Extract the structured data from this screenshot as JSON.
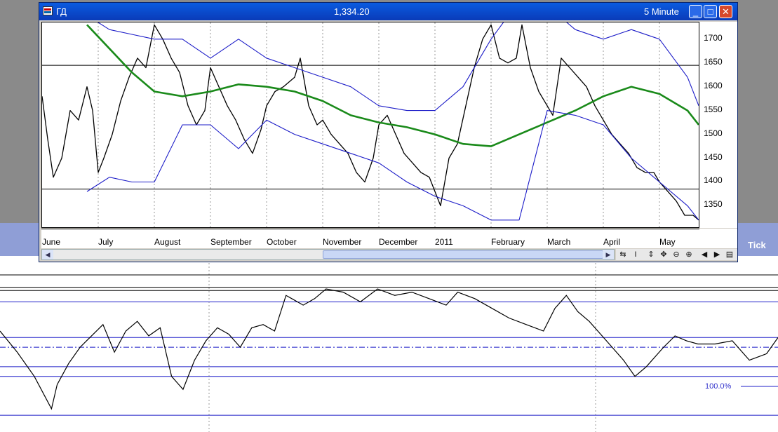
{
  "window": {
    "title": "ГД",
    "price": "1,334.20",
    "interval": "5 Minute",
    "minimize_glyph": "_",
    "maximize_glyph": "□",
    "close_glyph": "✕"
  },
  "background": {
    "tick_label": "Tick"
  },
  "colors": {
    "price": "#000000",
    "bands": "#1c1cc8",
    "moving_average": "#1a8a1a",
    "title_bar": "#0a4fd4",
    "indicator": "#000000"
  },
  "chart_data": [
    {
      "type": "line",
      "title": "",
      "xlabel": "",
      "ylabel": "",
      "x_tick_labels": [
        "June",
        "July",
        "August",
        "September",
        "October",
        "November",
        "December",
        "2011",
        "February",
        "March",
        "April",
        "May"
      ],
      "y_tick_labels": [
        "1700",
        "1650",
        "1600",
        "1550",
        "1500",
        "1450",
        "1400",
        "1350"
      ],
      "ylim": [
        1305,
        1735
      ],
      "x_positions_axis": "month index 0..11.7",
      "horizontal_lines": [
        1645,
        1385
      ],
      "grid": "vertical dotted at month starts",
      "legend": "none",
      "series": [
        {
          "role": "price",
          "x": [
            0,
            0.1,
            0.2,
            0.35,
            0.5,
            0.65,
            0.8,
            0.9,
            1.0,
            1.1,
            1.25,
            1.4,
            1.55,
            1.7,
            1.85,
            2.0,
            2.15,
            2.3,
            2.45,
            2.6,
            2.75,
            2.9,
            3.0,
            3.15,
            3.3,
            3.45,
            3.6,
            3.75,
            3.9,
            4.0,
            4.15,
            4.3,
            4.5,
            4.6,
            4.75,
            4.9,
            5.0,
            5.15,
            5.3,
            5.45,
            5.6,
            5.75,
            5.9,
            6.0,
            6.15,
            6.3,
            6.45,
            6.6,
            6.75,
            6.9,
            7.0,
            7.1,
            7.25,
            7.4,
            7.55,
            7.7,
            7.85,
            8.0,
            8.15,
            8.3,
            8.45,
            8.55,
            8.7,
            8.85,
            9.0,
            9.1,
            9.25,
            9.4,
            9.55,
            9.7,
            9.85,
            10.0,
            10.15,
            10.3,
            10.45,
            10.6,
            10.75,
            10.9,
            11.0,
            11.15,
            11.3,
            11.45,
            11.6,
            11.7
          ],
          "values": [
            1580,
            1490,
            1410,
            1450,
            1550,
            1530,
            1600,
            1550,
            1420,
            1450,
            1500,
            1570,
            1620,
            1660,
            1640,
            1730,
            1700,
            1660,
            1630,
            1560,
            1520,
            1550,
            1640,
            1600,
            1560,
            1530,
            1490,
            1460,
            1510,
            1560,
            1590,
            1600,
            1620,
            1660,
            1560,
            1520,
            1530,
            1500,
            1480,
            1460,
            1420,
            1400,
            1450,
            1520,
            1540,
            1500,
            1460,
            1440,
            1420,
            1410,
            1380,
            1350,
            1450,
            1480,
            1560,
            1640,
            1700,
            1730,
            1660,
            1650,
            1660,
            1730,
            1640,
            1590,
            1560,
            1540,
            1660,
            1640,
            1620,
            1600,
            1560,
            1530,
            1500,
            1480,
            1460,
            1430,
            1420,
            1420,
            1400,
            1380,
            1360,
            1330,
            1330,
            1320
          ]
        },
        {
          "role": "moving-average",
          "x": [
            0.8,
            1.2,
            1.6,
            2.0,
            2.5,
            3.0,
            3.5,
            4.0,
            4.5,
            5.0,
            5.5,
            6.0,
            6.5,
            7.0,
            7.5,
            8.0,
            8.5,
            9.0,
            9.5,
            10.0,
            10.5,
            11.0,
            11.5,
            11.7
          ],
          "values": [
            1730,
            1680,
            1630,
            1590,
            1580,
            1590,
            1605,
            1600,
            1590,
            1570,
            1540,
            1525,
            1515,
            1500,
            1480,
            1475,
            1500,
            1525,
            1550,
            1580,
            1600,
            1585,
            1550,
            1520
          ]
        },
        {
          "role": "upper-band",
          "x": [
            0.8,
            1.2,
            1.6,
            2.0,
            2.5,
            3.0,
            3.5,
            4.0,
            4.5,
            5.0,
            5.5,
            6.0,
            6.5,
            7.0,
            7.5,
            8.0,
            8.5,
            9.0,
            9.5,
            10.0,
            10.5,
            11.0,
            11.5,
            11.7
          ],
          "values": [
            1750,
            1720,
            1710,
            1700,
            1700,
            1660,
            1700,
            1660,
            1640,
            1620,
            1600,
            1560,
            1550,
            1550,
            1600,
            1700,
            1780,
            1770,
            1720,
            1700,
            1720,
            1700,
            1620,
            1560
          ]
        },
        {
          "role": "lower-band",
          "x": [
            0.8,
            1.2,
            1.6,
            2.0,
            2.5,
            3.0,
            3.5,
            4.0,
            4.5,
            5.0,
            5.5,
            6.0,
            6.5,
            7.0,
            7.5,
            8.0,
            8.5,
            9.0,
            9.5,
            10.0,
            10.5,
            11.0,
            11.5,
            11.7
          ],
          "values": [
            1380,
            1410,
            1400,
            1400,
            1520,
            1520,
            1470,
            1530,
            1500,
            1480,
            1460,
            1440,
            1400,
            1370,
            1350,
            1320,
            1320,
            1550,
            1540,
            1520,
            1450,
            1400,
            1350,
            1320
          ]
        }
      ]
    },
    {
      "type": "line",
      "title": "",
      "xlabel": "",
      "ylabel": "",
      "annotations": [
        "100.0%"
      ],
      "ylim": [
        0,
        100
      ],
      "horizontal_levels": [
        85,
        83,
        76,
        54,
        48,
        36,
        30,
        6
      ],
      "legend": "none",
      "series": [
        {
          "role": "indicator",
          "x": [
            0,
            0.3,
            0.6,
            0.9,
            1.0,
            1.2,
            1.4,
            1.6,
            1.8,
            2.0,
            2.2,
            2.4,
            2.6,
            2.8,
            3.0,
            3.2,
            3.4,
            3.6,
            3.8,
            4.0,
            4.2,
            4.4,
            4.6,
            4.8,
            5.0,
            5.1,
            5.3,
            5.5,
            5.7,
            6.0,
            6.3,
            6.6,
            6.9,
            7.2,
            7.5,
            7.8,
            8.0,
            8.3,
            8.6,
            8.9,
            9.2,
            9.5,
            9.7,
            9.9,
            10.1,
            10.3,
            10.6,
            10.9,
            11.1,
            11.3,
            11.6,
            11.8,
            12.0,
            12.2,
            12.5,
            12.8,
            13.1,
            13.4,
            13.6
          ],
          "values": [
            58,
            45,
            30,
            10,
            25,
            38,
            48,
            55,
            62,
            45,
            58,
            64,
            55,
            60,
            30,
            22,
            40,
            52,
            60,
            56,
            48,
            60,
            62,
            58,
            80,
            78,
            74,
            78,
            84,
            82,
            76,
            84,
            80,
            82,
            78,
            74,
            82,
            78,
            72,
            66,
            62,
            58,
            72,
            80,
            70,
            64,
            52,
            40,
            30,
            36,
            48,
            55,
            52,
            50,
            50,
            52,
            40,
            44,
            54
          ]
        }
      ]
    }
  ]
}
